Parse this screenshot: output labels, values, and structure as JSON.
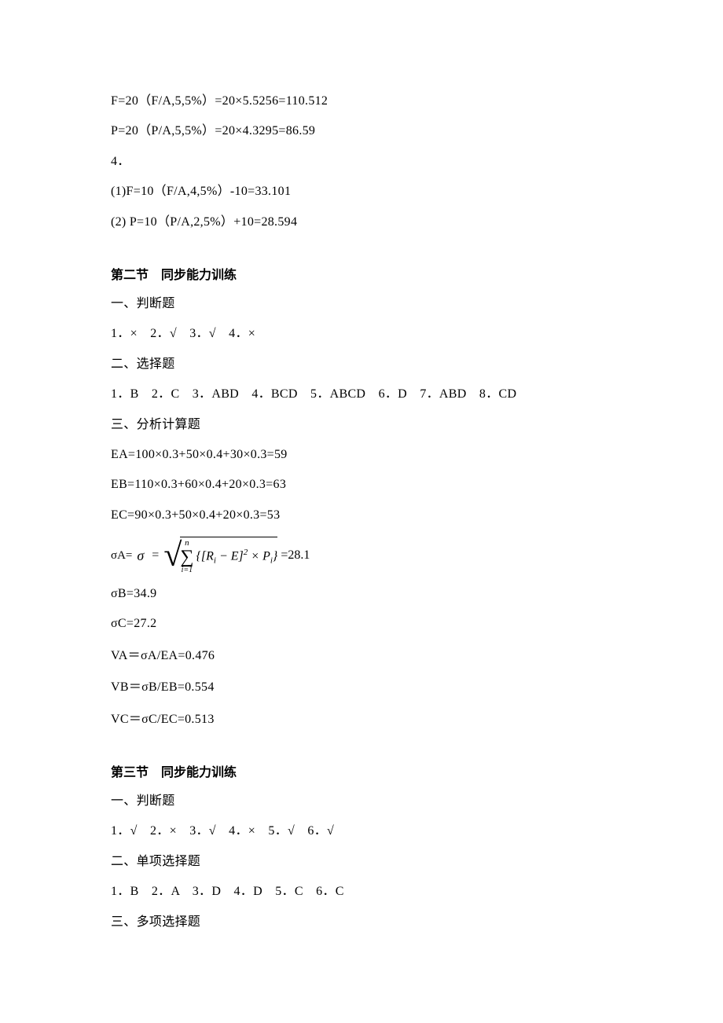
{
  "top_lines": {
    "l1": "F=20（F/A,5,5%）=20×5.5256=110.512",
    "l2": "P=20（P/A,5,5%）=20×4.3295=86.59",
    "l3": "4．",
    "l4": "(1)F=10（F/A,4,5%）-10=33.101",
    "l5": "(2) P=10（P/A,2,5%）+10=28.594"
  },
  "section2": {
    "heading": "第二节　同步能力训练",
    "h1": "一、判断题",
    "a1": "1．×　2．√　3．√　4．×",
    "h2": "二、选择题",
    "a2": "1．B　2．C　3．ABD　4．BCD　5．ABCD　6．D　7．ABD　8．CD",
    "h3": "三、分析计算题",
    "ea": "EA=100×0.3+50×0.4+30×0.3=59",
    "eb": "EB=110×0.3+60×0.4+20×0.3=63",
    "ec": "EC=90×0.3+50×0.4+20×0.3=53",
    "sigmaA_prefix": "σA=",
    "sigmaA_symbol": "σ",
    "sigmaA_eq1": "=",
    "formula_sum_top": "n",
    "formula_sum_bot": "i=1",
    "formula_body_left": "{[",
    "formula_R": "R",
    "formula_i1": "i",
    "formula_mid1": " − ",
    "formula_E": "E",
    "formula_mid2": "]",
    "formula_sq": "2",
    "formula_times": " × ",
    "formula_P": "P",
    "formula_i2": "i",
    "formula_body_right": "}",
    "sigmaA_result": " =28.1",
    "sigmaB": "σB=34.9",
    "sigmaC": "σC=27.2",
    "va": "VA＝σA/EA=0.476",
    "vb": "VB＝σB/EB=0.554",
    "vc": "VC＝σC/EC=0.513"
  },
  "section3": {
    "heading": "第三节　同步能力训练",
    "h1": "一、判断题",
    "a1": "1．√　2．×　3．√　4．×　5．√　6．√",
    "h2": "二、单项选择题",
    "a2": "1．B　2．A　3．D　4．D　5．C　6．C",
    "h3": "三、多项选择题"
  }
}
